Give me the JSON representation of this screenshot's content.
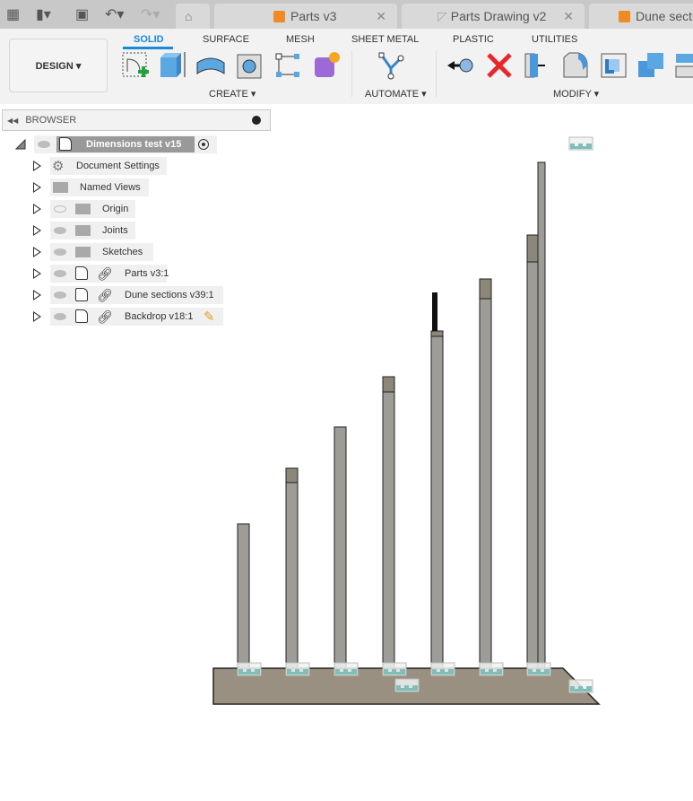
{
  "topbar": {
    "icons": [
      "grid-menu-icon",
      "file-icon",
      "save-icon",
      "undo-icon",
      "redo-icon",
      "home-icon"
    ],
    "tabs": [
      {
        "label": "Parts v3",
        "icon": "orange-cube-icon"
      },
      {
        "label": "Parts Drawing v2",
        "icon": "drawing-icon"
      },
      {
        "label": "Dune sectio",
        "icon": "orange-cube-icon"
      }
    ]
  },
  "ribbon": {
    "workspace": "DESIGN ▾",
    "tabs": [
      "SOLID",
      "SURFACE",
      "MESH",
      "SHEET METAL",
      "PLASTIC",
      "UTILITIES"
    ],
    "active_tab": "SOLID",
    "groups": {
      "create": "CREATE ▾",
      "automate": "AUTOMATE ▾",
      "modify": "MODIFY ▾"
    },
    "accent": "#1a8ad4"
  },
  "browser": {
    "title": "BROWSER",
    "root": "Dimensions test v15",
    "items": [
      {
        "label": "Document Settings",
        "icon": "gear-icon"
      },
      {
        "label": "Named Views",
        "icon": "folder-icon"
      },
      {
        "label": "Origin",
        "icon": "folder-icon",
        "hidden": true
      },
      {
        "label": "Joints",
        "icon": "folder-icon"
      },
      {
        "label": "Sketches",
        "icon": "folder-icon"
      },
      {
        "label": "Parts v3:1",
        "icon": "component-link-icon"
      },
      {
        "label": "Dune sections v39:1",
        "icon": "component-link-icon"
      },
      {
        "label": "Backdrop v18:1",
        "icon": "component-link-icon",
        "editing": true
      }
    ]
  },
  "viewport": {
    "post_color": "#9e9c96",
    "base_color": "#9a9082",
    "joint_color": "#7fbfb8"
  }
}
